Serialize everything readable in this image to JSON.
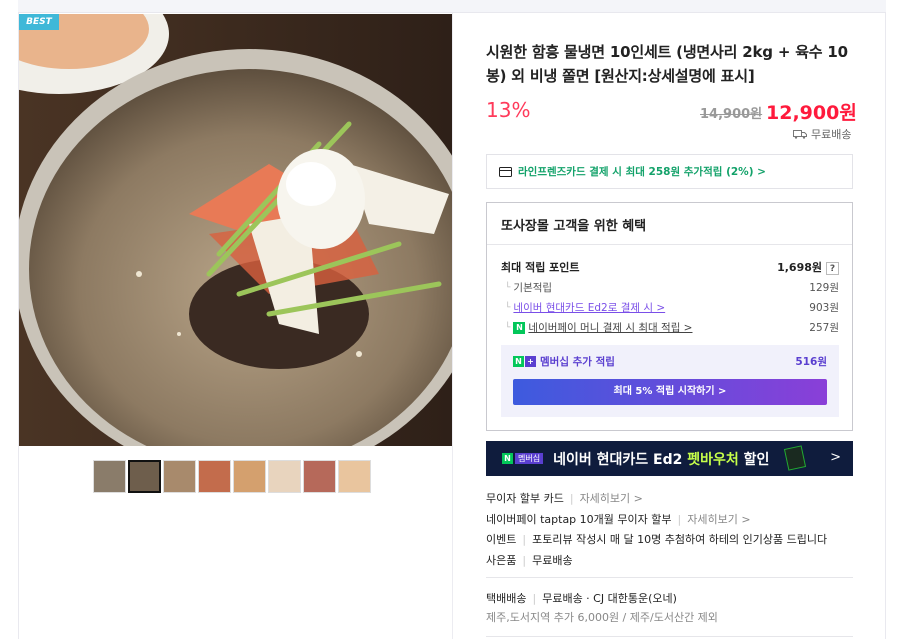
{
  "product": {
    "badge": "BEST",
    "title": "시원한 함흥 물냉면 10인세트 (냉면사리 2kg + 육수 10봉) 외 비냉 쫄면 [원산지:상세설명에 표시]",
    "discount": "13%",
    "original_price": "14,900원",
    "sale_price": "12,900원",
    "shipping": "무료배송"
  },
  "card_promo": "라인프렌즈카드 결제 시 최대 258원 추가적립 (2%) >",
  "benefit": {
    "heading": "또사장몰 고객을 위한 혜택",
    "max_label": "최대 적립 포인트",
    "max_value": "1,698원",
    "help": "?",
    "rows": [
      {
        "label": "기본적립",
        "value": "129원"
      },
      {
        "label": "네이버 현대카드 Ed2로 결제 시 >",
        "value": "903원"
      },
      {
        "label": "네이버페이 머니 결제 시 최대 적립 >",
        "value": "257원"
      }
    ],
    "member_label": "멤버십 추가 적립",
    "member_value": "516원",
    "member_button": "최대 5% 적립 시작하기 >"
  },
  "banner": {
    "badge": "멤버십",
    "text_a": "네이버 현대카드 Ed2 ",
    "text_b": "펫바우처",
    "text_c": " 할인",
    "chevron": ">"
  },
  "info": {
    "installment_label": "무이자 할부 카드",
    "installment_more": "자세히보기 >",
    "taptap_label": "네이버페이 taptap 10개월 무이자 할부",
    "taptap_more": "자세히보기 >",
    "event_label": "이벤트",
    "event_text": "포토리뷰 작성시 매 달 10명 추첨하여 하테의 인기상품 드립니다",
    "gift_label": "사은품",
    "gift_text": "무료배송",
    "delivery_label": "택배배송",
    "delivery_text": "무료배송 · CJ 대한통운(오네)",
    "delivery_note": "제주,도서지역 추가 6,000원 / 제주/도서산간 제외"
  },
  "colors": {
    "discount": "#ff3a5a",
    "promo_green": "#13a26a",
    "membership_purple": "#5a3fd0",
    "banner_bg": "#0f1c3d"
  },
  "thumbnails": [
    "thumb-1",
    "thumb-2",
    "thumb-3",
    "thumb-4",
    "thumb-5",
    "thumb-6",
    "thumb-7",
    "thumb-8"
  ]
}
